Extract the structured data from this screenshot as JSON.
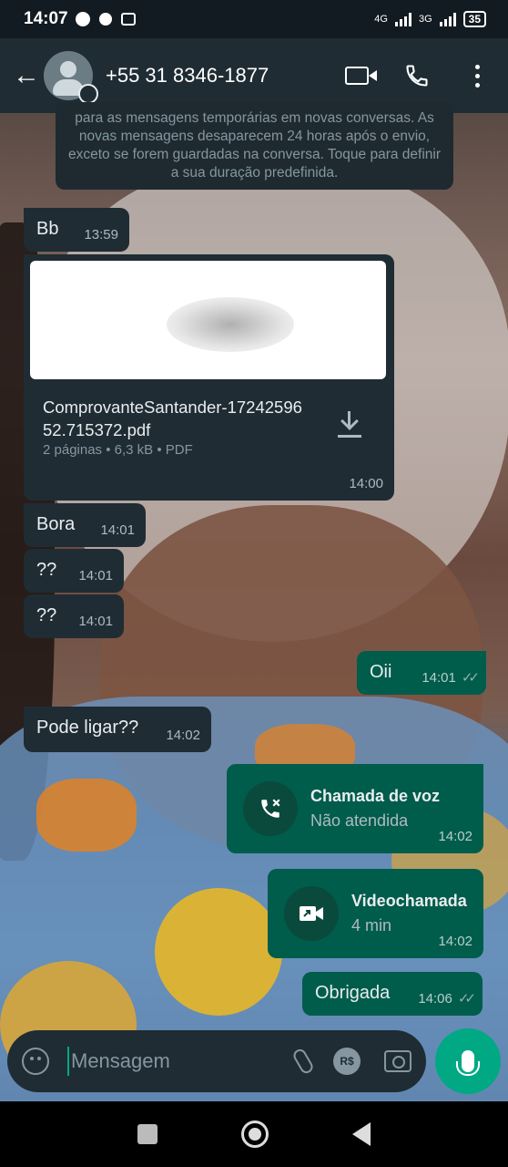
{
  "status_bar": {
    "time": "14:07",
    "network1": "4G",
    "network2": "3G",
    "battery": "35"
  },
  "header": {
    "contact_name": "+55 31 8346-1877"
  },
  "notice": {
    "text": "para as mensagens temporárias em novas conversas. As novas mensagens desaparecem 24 horas após o envio, exceto se forem guardadas na conversa. Toque para definir a sua duração predefinida."
  },
  "messages": [
    {
      "direction": "in",
      "text": "Bb",
      "time": "13:59"
    },
    {
      "direction": "in",
      "type": "document",
      "filename": "ComprovanteSantander-1724259652.715372.pdf",
      "info": "2 páginas • 6,3 kB • PDF",
      "time": "14:00"
    },
    {
      "direction": "in",
      "text": "Bora",
      "time": "14:01"
    },
    {
      "direction": "in",
      "text": "??",
      "time": "14:01"
    },
    {
      "direction": "in",
      "text": "??",
      "time": "14:01"
    },
    {
      "direction": "out",
      "text": "Oii",
      "time": "14:01",
      "status": "read"
    },
    {
      "direction": "in",
      "text": "Pode ligar??",
      "time": "14:02"
    },
    {
      "direction": "out",
      "type": "call",
      "title": "Chamada de voz",
      "subtitle": "Não atendida",
      "time": "14:02",
      "icon": "missed-call-icon"
    },
    {
      "direction": "out",
      "type": "call",
      "title": "Videochamada",
      "subtitle": "4 min",
      "time": "14:02",
      "icon": "video-call-icon"
    },
    {
      "direction": "out",
      "text": "Obrigada",
      "time": "14:06",
      "status": "read"
    }
  ],
  "input": {
    "placeholder": "Mensagem",
    "currency_label": "R$"
  },
  "colors": {
    "accent": "#00a884",
    "incoming_bubble": "#1f2c34",
    "outgoing_bubble": "#005c4b",
    "header": "#1f2c34"
  }
}
